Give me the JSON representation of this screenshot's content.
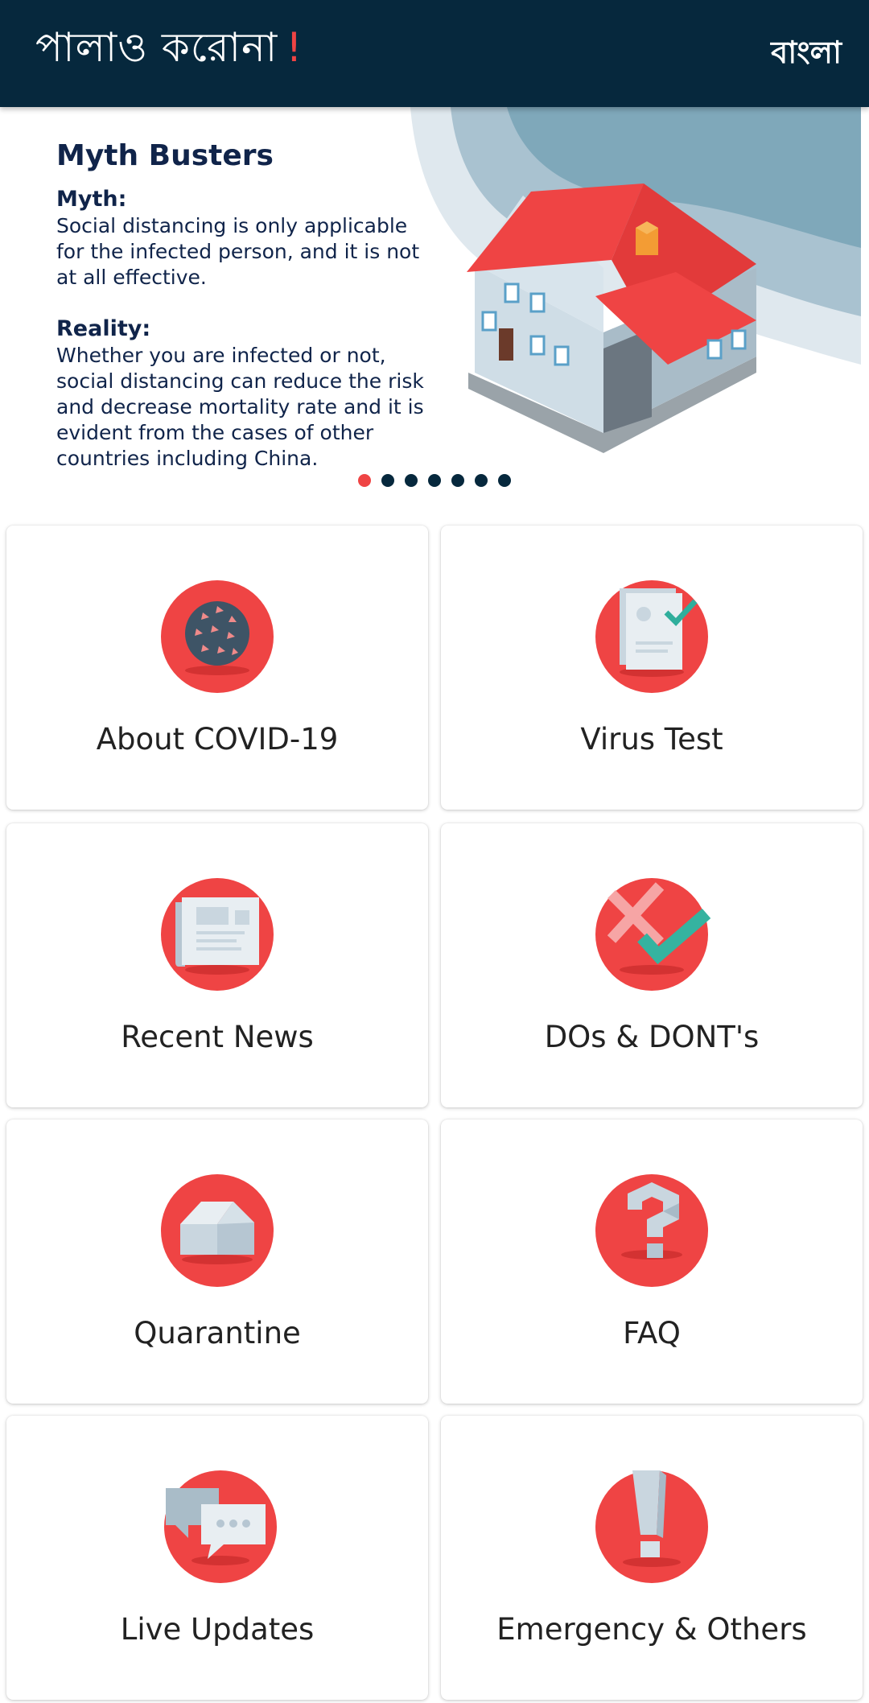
{
  "appbar": {
    "title": "পালাও করোনা",
    "title_mark": "!",
    "language_button": "বাংলা",
    "background": "#06283d",
    "accent": "#ef4444"
  },
  "banner": {
    "title": "Myth Busters",
    "myth_label": "Myth:",
    "myth_text": "Social distancing is only applicable for the infected person, and it is not at all effective.",
    "reality_label": "Reality:",
    "reality_text": "Whether you are infected or not, social distancing can reduce the risk and decrease mortality rate and it is evident from the cases of other countries including China.",
    "image": "house-illustration",
    "page_count": 7,
    "active_page": 1
  },
  "menu": [
    {
      "label": "About COVID-19",
      "icon": "virus-icon"
    },
    {
      "label": "Virus Test",
      "icon": "test-document-icon"
    },
    {
      "label": "Recent News",
      "icon": "newspaper-icon"
    },
    {
      "label": "DOs & DONT's",
      "icon": "cross-check-icon"
    },
    {
      "label": "Quarantine",
      "icon": "house-icon"
    },
    {
      "label": "FAQ",
      "icon": "question-mark-icon"
    },
    {
      "label": "Live Updates",
      "icon": "chat-bubbles-icon"
    },
    {
      "label": "Emergency & Others",
      "icon": "exclamation-icon"
    }
  ]
}
